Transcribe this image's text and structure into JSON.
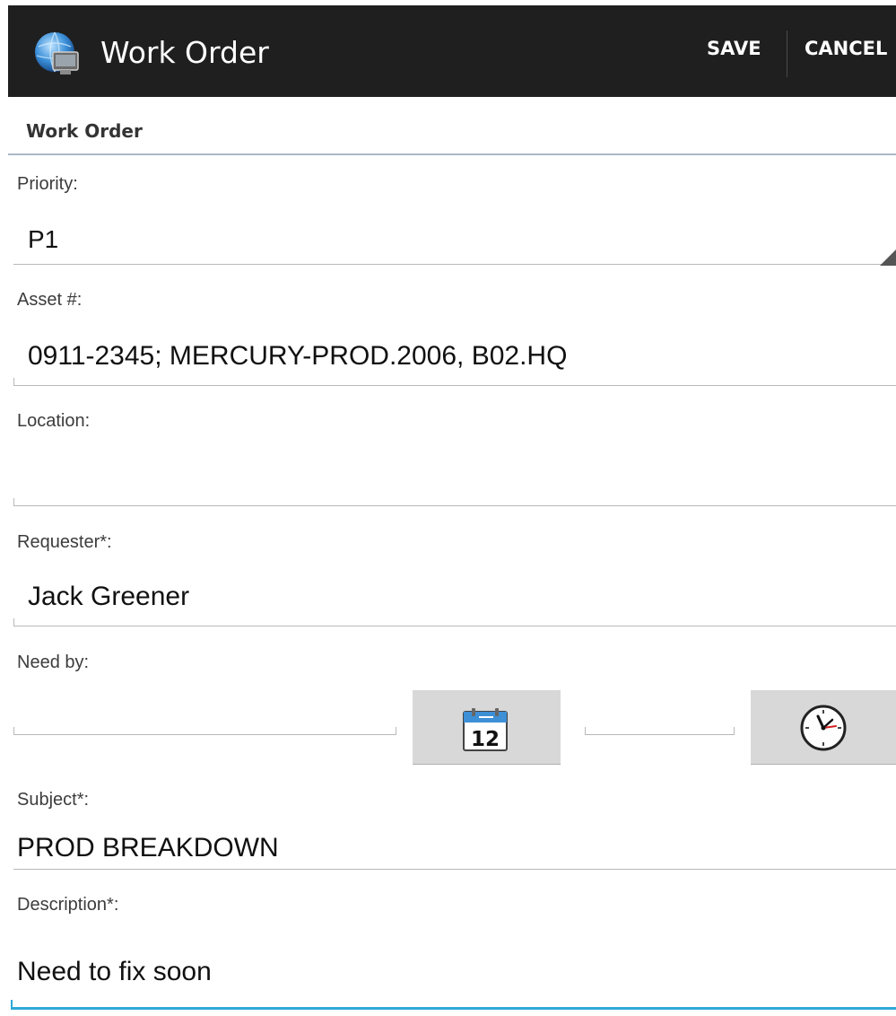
{
  "action_bar": {
    "title": "Work Order",
    "save_label": "SAVE",
    "cancel_label": "CANCEL",
    "app_icon": "globe-computer-icon"
  },
  "section": {
    "header": "Work Order"
  },
  "fields": {
    "priority": {
      "label": "Priority:",
      "value": "P1"
    },
    "asset": {
      "label": "Asset #:",
      "value": "0911-2345;  MERCURY-PROD.2006, B02.HQ"
    },
    "location": {
      "label": "Location:",
      "value": ""
    },
    "requester": {
      "label": "Requester*:",
      "value": "Jack Greener"
    },
    "need_by": {
      "label": "Need by:",
      "date_value": "",
      "time_value": "",
      "date_icon": "calendar-icon",
      "time_icon": "clock-icon",
      "calendar_day": "12"
    },
    "subject": {
      "label": "Subject*:",
      "value": "PROD BREAKDOWN"
    },
    "description": {
      "label": "Description*:",
      "value": "Need to fix soon"
    }
  },
  "colors": {
    "action_bar_bg": "#1f1f1f",
    "focus_accent": "#2fa8d8",
    "section_divider": "#a9b8c8",
    "button_bg": "#d8d8d8"
  }
}
